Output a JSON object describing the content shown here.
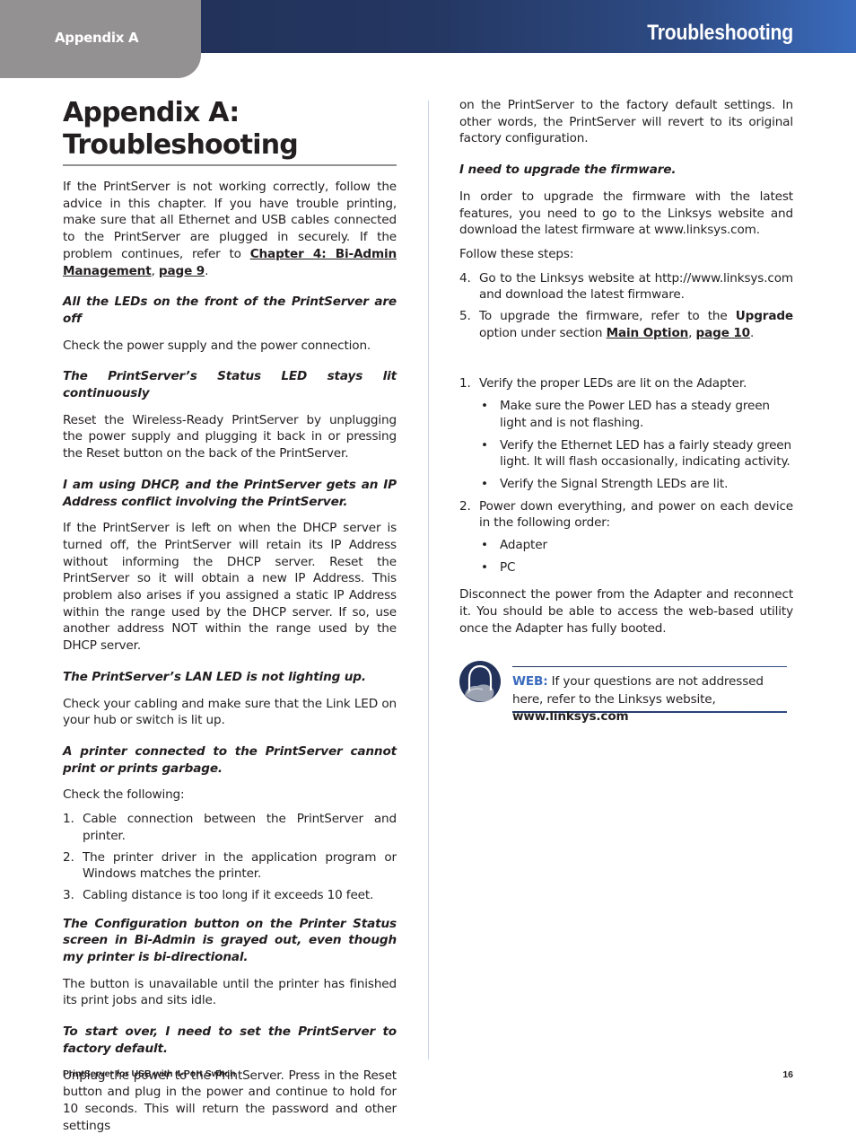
{
  "header": {
    "tab_label": "Appendix A",
    "section_title": "Troubleshooting"
  },
  "colors": {
    "tab_gray": "#939191",
    "banner_dark": "#22325a",
    "banner_light": "#3a6bbd",
    "web_label_blue": "#3a6bbd"
  },
  "left": {
    "title_line1": "Appendix A:",
    "title_line2": "Troubleshooting",
    "intro": "If the PrintServer is not working correctly, follow the advice in this chapter. If you have trouble printing, make sure that all Ethernet and USB cables connected to the PrintServer are plugged in securely. If the problem continues, refer to ",
    "intro_link1": "Chapter 4:  Bi-Admin Management",
    "intro_sep": ", ",
    "intro_link2": "page 9",
    "intro_end": ".",
    "q1": "All the LEDs on the front of the PrintServer are off",
    "a1": "Check the power supply and the power connection.",
    "q2": "The PrintServer’s Status LED stays lit continuously",
    "a2": "Reset the Wireless-Ready PrintServer by unplugging the power supply and plugging it back in or pressing the Reset button on the back of the PrintServer.",
    "q3": "I am using DHCP, and the PrintServer gets an IP Address conflict involving the PrintServer.",
    "a3": "If the PrintServer is left on when the DHCP server is turned off, the PrintServer will retain its IP Address without informing the DHCP server. Reset the PrintServer so it will obtain a new IP Address. This problem also arises if you assigned a static IP Address within the range used by the DHCP server. If so, use another address NOT within the range used by the DHCP server.",
    "q4": "The PrintServer’s LAN LED is not lighting up.",
    "a4": "Check your cabling and make sure that the Link LED on your hub or switch is lit up.",
    "q5": "A printer connected to the PrintServer cannot print or prints garbage.",
    "a5": "Check the following:",
    "list5": [
      {
        "num": "1.",
        "text": "Cable connection between the PrintServer and printer."
      },
      {
        "num": "2.",
        "text": "The printer driver in the application program or Windows matches the printer."
      },
      {
        "num": "3.",
        "text": "Cabling distance is too long if it exceeds 10 feet."
      }
    ],
    "q6": "The Configuration button on the Printer Status screen in Bi-Admin is grayed out, even though my printer is bi-directional.",
    "a6": "The button is unavailable until the printer has finished its print jobs and sits idle.",
    "q7": "To start over, I need to set the PrintServer to factory default.",
    "a7": "Unplug the power to the PrintServer. Press in the Reset button and plug in the power and continue to hold for 10 seconds. This will return the password and other settings"
  },
  "right": {
    "a7_cont": "on the PrintServer to the factory default settings. In other words, the PrintServer will revert to its original factory configuration.",
    "q8": "I need to upgrade the firmware.",
    "a8": "In order to upgrade the firmware with the latest features, you need to go to the Linksys website and download the latest firmware at www.linksys.com.",
    "a8_follow": "Follow these steps:",
    "steps": [
      {
        "num": "4.",
        "text": "Go to the Linksys website at http://www.linksys.com and download the latest firmware."
      }
    ],
    "step5_num": "5.",
    "step5_pre": "To upgrade the firmware, refer to the ",
    "step5_bold": "Upgrade",
    "step5_mid": " option under section ",
    "step5_link1": "Main Option",
    "step5_sep": ", ",
    "step5_link2": "page 10",
    "step5_end": ".",
    "adapter_step1_num": "1.",
    "adapter_step1": "Verify the proper LEDs are lit on the Adapter.",
    "adapter_step1_bullets": [
      "Make sure the Power LED has a steady green light and is not flashing.",
      "Verify the Ethernet LED has a fairly steady green light. It will flash occasionally, indicating activity.",
      "Verify the Signal Strength LEDs are lit."
    ],
    "adapter_step2_num": "2.",
    "adapter_step2": "Power down everything, and power on each device in the following order:",
    "adapter_step2_bullets": [
      "Adapter",
      "PC"
    ],
    "bullet_glyph": "•",
    "closing": "Disconnect the power from the Adapter and reconnect it. You should be able to access the web-based utility once the Adapter has fully booted.",
    "note": {
      "icon": "globe-web-icon",
      "label": "WEB:",
      "text": " If your questions are not addressed here, refer to the Linksys website, ",
      "url": "www.linksys.com"
    }
  },
  "footer": {
    "product": "PrintServer for USB with 4-Port Switch",
    "page_number": "16"
  }
}
